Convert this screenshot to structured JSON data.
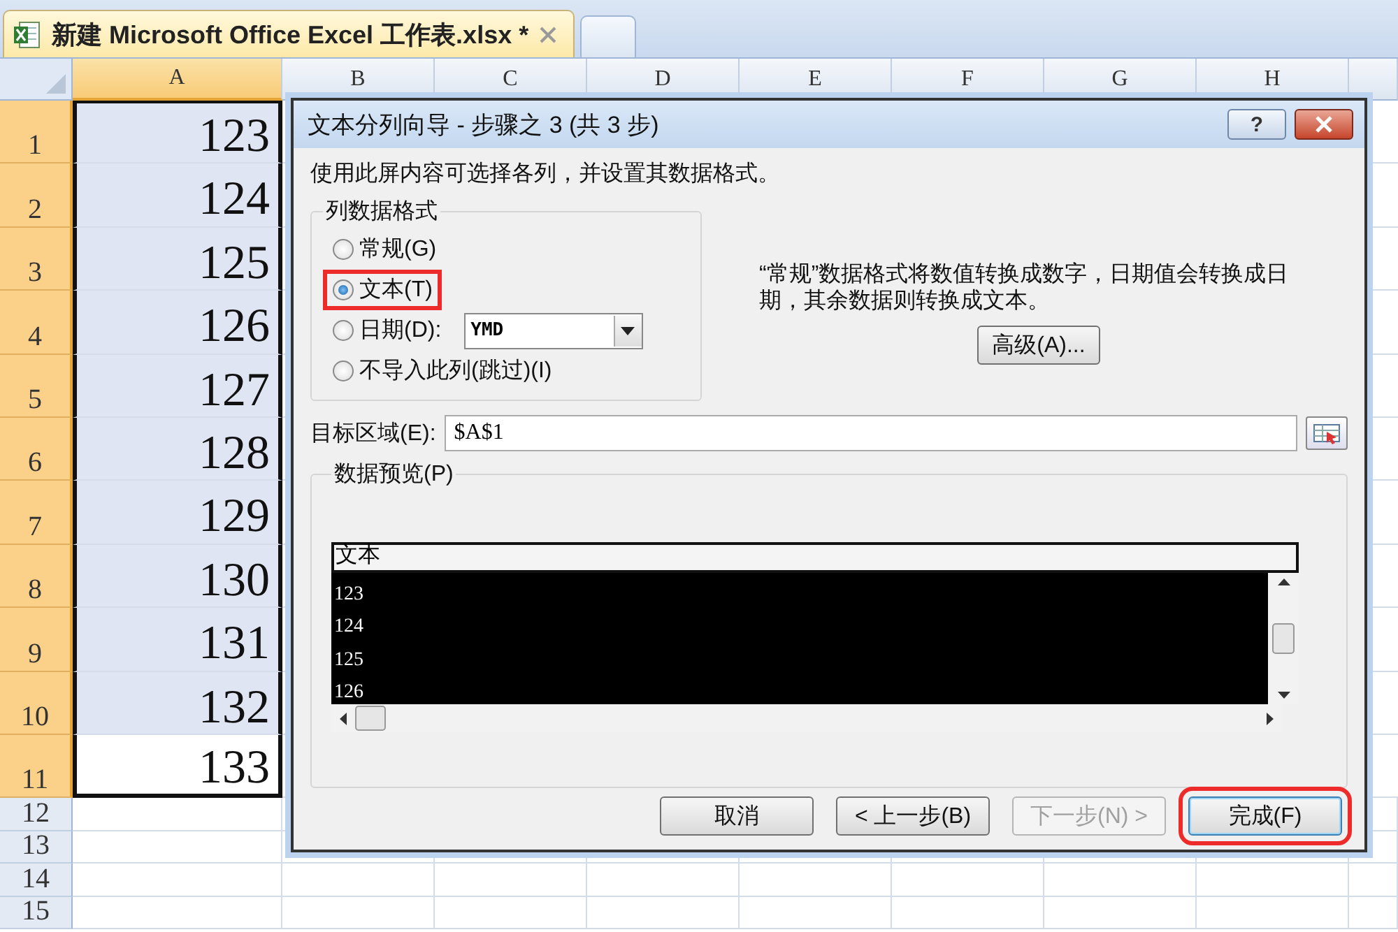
{
  "tab": {
    "title": "新建 Microsoft Office Excel 工作表.xlsx *"
  },
  "columns": [
    {
      "label": "A",
      "selected": true
    },
    {
      "label": "B",
      "selected": false
    },
    {
      "label": "C",
      "selected": false
    },
    {
      "label": "D",
      "selected": false
    },
    {
      "label": "E",
      "selected": false
    },
    {
      "label": "F",
      "selected": false
    },
    {
      "label": "G",
      "selected": false
    },
    {
      "label": "H",
      "selected": false
    }
  ],
  "rows": [
    {
      "number": "1",
      "value": "123",
      "selected": true,
      "active": false
    },
    {
      "number": "2",
      "value": "124",
      "selected": true,
      "active": false
    },
    {
      "number": "3",
      "value": "125",
      "selected": true,
      "active": false
    },
    {
      "number": "4",
      "value": "126",
      "selected": true,
      "active": false
    },
    {
      "number": "5",
      "value": "127",
      "selected": true,
      "active": false
    },
    {
      "number": "6",
      "value": "128",
      "selected": true,
      "active": false
    },
    {
      "number": "7",
      "value": "129",
      "selected": true,
      "active": false
    },
    {
      "number": "8",
      "value": "130",
      "selected": true,
      "active": false
    },
    {
      "number": "9",
      "value": "131",
      "selected": true,
      "active": false
    },
    {
      "number": "10",
      "value": "132",
      "selected": true,
      "active": false
    },
    {
      "number": "11",
      "value": "133",
      "selected": true,
      "active": true
    },
    {
      "number": "12",
      "selected": false
    },
    {
      "number": "13",
      "selected": false
    },
    {
      "number": "14",
      "selected": false
    },
    {
      "number": "15",
      "selected": false
    }
  ],
  "dialog": {
    "title": "文本分列向导 - 步骤之 3 (共 3 步)",
    "help": "?",
    "intro": "使用此屏内容可选择各列，并设置其数据格式。",
    "format_group": {
      "label": "列数据格式",
      "options": [
        {
          "label": "常规(G)",
          "selected": false,
          "highlighted": false
        },
        {
          "label": "文本(T)",
          "selected": true,
          "highlighted": true
        },
        {
          "label": "日期(D):",
          "selected": false,
          "highlighted": false,
          "dropdown": "YMD"
        },
        {
          "label": "不导入此列(跳过)(I)",
          "selected": false,
          "highlighted": false
        }
      ]
    },
    "description": "“常规”数据格式将数值转换成数字，日期值会转换成日期，其余数据则转换成文本。",
    "advanced_button": "高级(A)...",
    "destination": {
      "label": "目标区域(E):",
      "value": "$A$1"
    },
    "preview": {
      "label": "数据预览(P)",
      "header": "文本",
      "rows": [
        "123",
        "124",
        "125",
        "126"
      ]
    },
    "buttons": [
      {
        "label": "取消",
        "disabled": false,
        "highlighted": false
      },
      {
        "label": "< 上一步(B)",
        "disabled": false,
        "highlighted": false
      },
      {
        "label": "下一步(N) >",
        "disabled": true,
        "highlighted": false
      },
      {
        "label": "完成(F)",
        "disabled": false,
        "highlighted": true
      }
    ]
  }
}
